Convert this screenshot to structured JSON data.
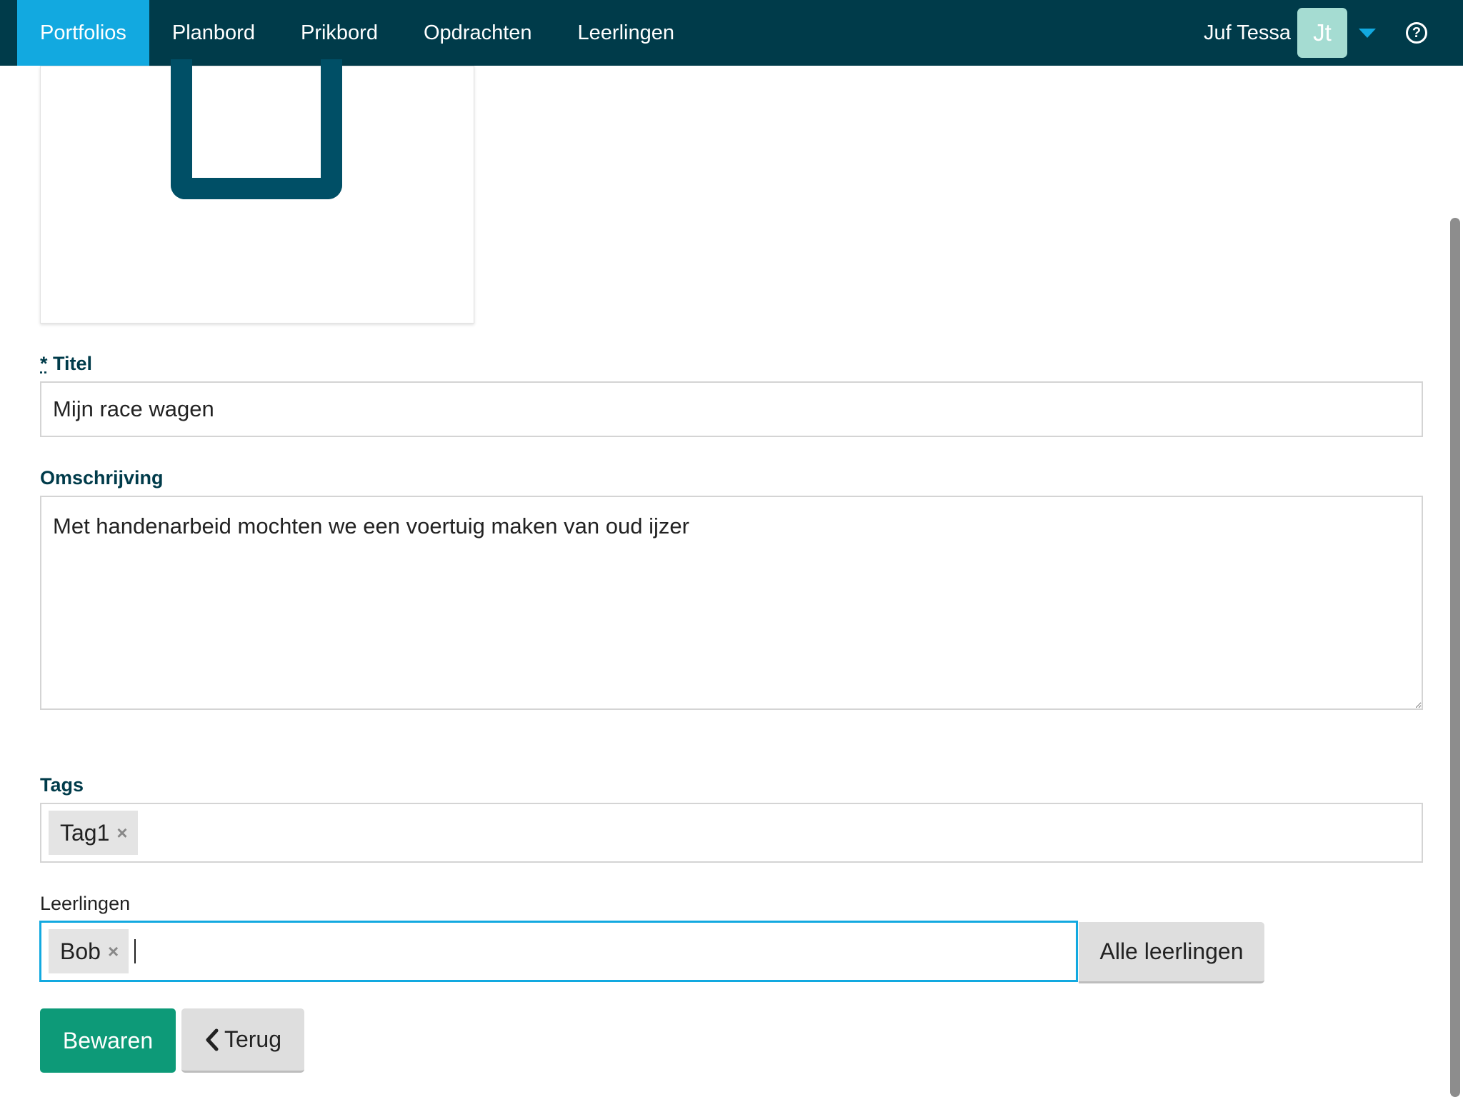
{
  "nav": {
    "items": [
      {
        "label": "Portfolios",
        "active": true
      },
      {
        "label": "Planbord",
        "active": false
      },
      {
        "label": "Prikbord",
        "active": false
      },
      {
        "label": "Opdrachten",
        "active": false
      },
      {
        "label": "Leerlingen",
        "active": false
      }
    ],
    "user_name": "Juf Tessa",
    "avatar_initials": "Jt"
  },
  "form": {
    "title": {
      "required_mark": "*",
      "label": "Titel",
      "value": "Mijn race wagen"
    },
    "description": {
      "label": "Omschrijving",
      "value": "Met handenarbeid mochten we een voertuig maken van oud ijzer"
    },
    "tags": {
      "label": "Tags",
      "items": [
        "Tag1"
      ],
      "remove_symbol": "×"
    },
    "students": {
      "label": "Leerlingen",
      "items": [
        "Bob"
      ],
      "remove_symbol": "×",
      "all_button": "Alle leerlingen"
    },
    "save_button": "Bewaren",
    "back_button": "Terug"
  },
  "colors": {
    "nav_bg": "#003b4a",
    "nav_active": "#12a9e0",
    "avatar_bg": "#a5dcd2",
    "save_button_bg": "#0d9a78",
    "label_color": "#003b4a",
    "focus_border": "#12a9e0"
  },
  "icons": [
    "caret-down-icon",
    "help-circle-icon",
    "chevron-left-icon",
    "remove-x-icon"
  ]
}
